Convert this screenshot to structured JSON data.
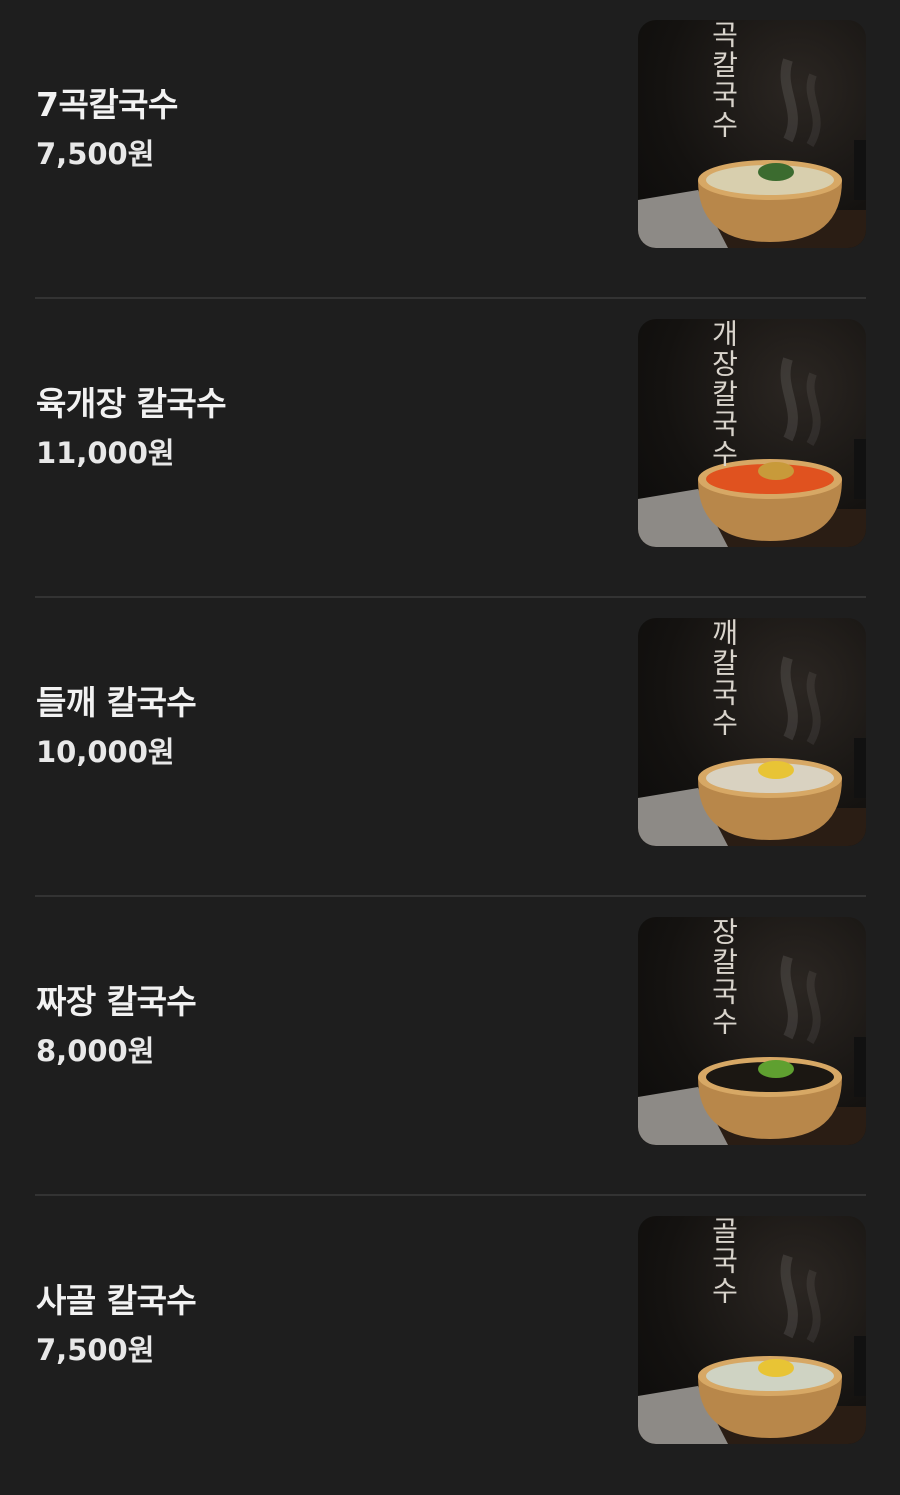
{
  "menu": {
    "items": [
      {
        "name": "7곡칼국수",
        "price": "7,500원",
        "poster_title": "곡칼국수",
        "soup": "#d8cfae",
        "topping": "#3b6b2f"
      },
      {
        "name": "육개장 칼국수",
        "price": "11,000원",
        "poster_title": "개장칼국수",
        "soup": "#e0521f",
        "topping": "#c89a3a"
      },
      {
        "name": "들깨 칼국수",
        "price": "10,000원",
        "poster_title": "깨칼국수",
        "soup": "#d9d2c1",
        "topping": "#e8c435"
      },
      {
        "name": "짜장 칼국수",
        "price": "8,000원",
        "poster_title": "장칼국수",
        "soup": "#1b1712",
        "topping": "#5fa030"
      },
      {
        "name": "사골 칼국수",
        "price": "7,500원",
        "poster_title": "골국수",
        "soup": "#cfd3c3",
        "topping": "#e8c435"
      }
    ]
  },
  "colors": {
    "background": "#1e1e1e",
    "divider": "#333333",
    "text": "#ffffff",
    "bowl": "#b8874a"
  }
}
